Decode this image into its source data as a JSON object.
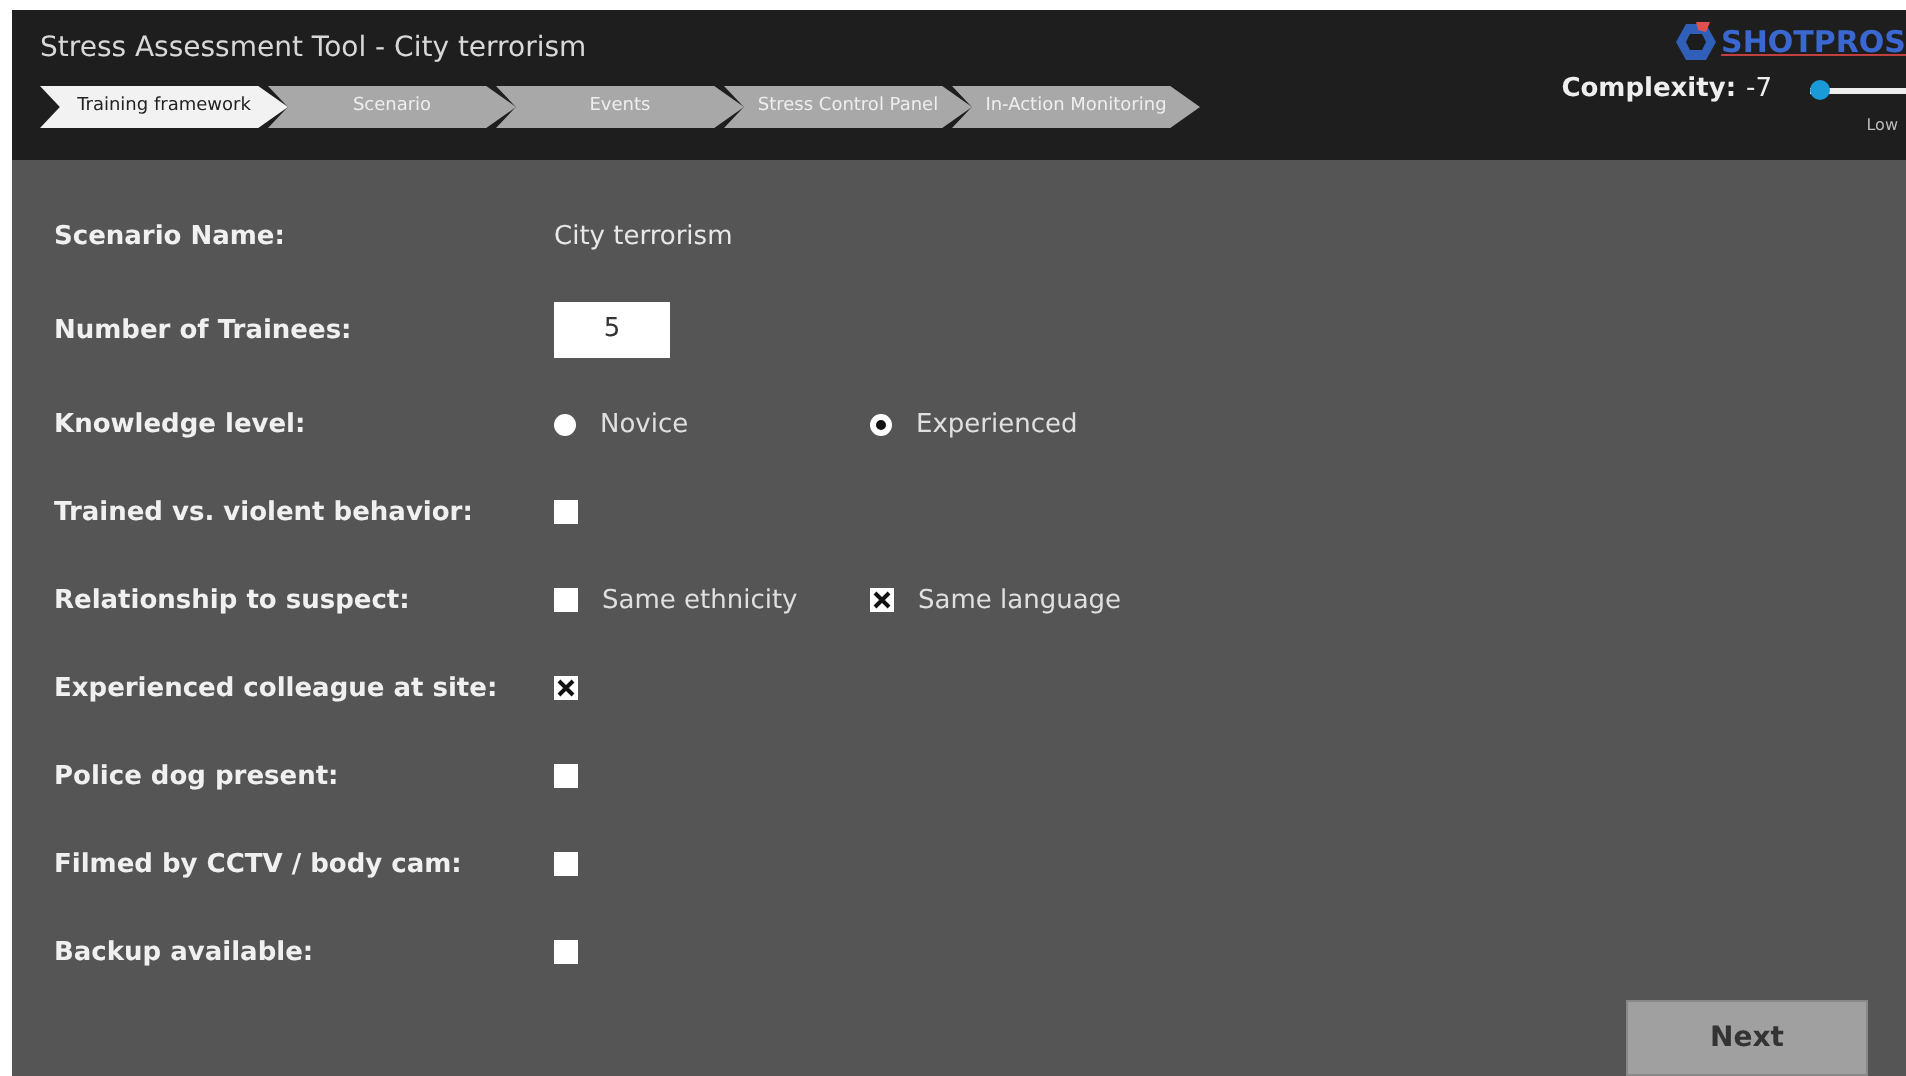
{
  "window": {
    "title": "Stress Assessment Tool - City terrorism"
  },
  "logo": {
    "text": "SHOTPROS"
  },
  "steps": [
    {
      "label": "Training framework",
      "selected": true
    },
    {
      "label": "Scenario",
      "selected": false
    },
    {
      "label": "Events",
      "selected": false
    },
    {
      "label": "Stress Control Panel",
      "selected": false
    },
    {
      "label": "In-Action Monitoring",
      "selected": false
    }
  ],
  "complexity": {
    "label": "Complexity:",
    "value": "-7",
    "level": 0.0,
    "caption": "Low"
  },
  "fields": [
    {
      "kind": "text",
      "label": "Scenario Name:",
      "value": "City terrorism"
    },
    {
      "kind": "number",
      "label": "Number of Trainees:",
      "value": "5"
    },
    {
      "kind": "radio",
      "label": "Knowledge level:",
      "options": [
        {
          "label": "Novice",
          "selected": false
        },
        {
          "label": "Experienced",
          "selected": true
        }
      ]
    },
    {
      "kind": "checkbox",
      "label": "Trained vs. violent behavior:",
      "options": [
        {
          "checked": false
        }
      ]
    },
    {
      "kind": "checkbox",
      "label": "Relationship to suspect:",
      "options": [
        {
          "label": "Same ethnicity",
          "checked": false
        },
        {
          "label": "Same language",
          "checked": true
        }
      ]
    },
    {
      "kind": "checkbox",
      "label": "Experienced colleague at site:",
      "options": [
        {
          "checked": true
        }
      ]
    },
    {
      "kind": "checkbox",
      "label": "Police dog present:",
      "options": [
        {
          "checked": false
        }
      ]
    },
    {
      "kind": "checkbox",
      "label": "Filmed by CCTV / body cam:",
      "options": [
        {
          "checked": false
        }
      ]
    },
    {
      "kind": "checkbox",
      "label": "Backup available:",
      "options": [
        {
          "checked": false
        }
      ]
    }
  ],
  "next_button": {
    "label": "Next"
  }
}
